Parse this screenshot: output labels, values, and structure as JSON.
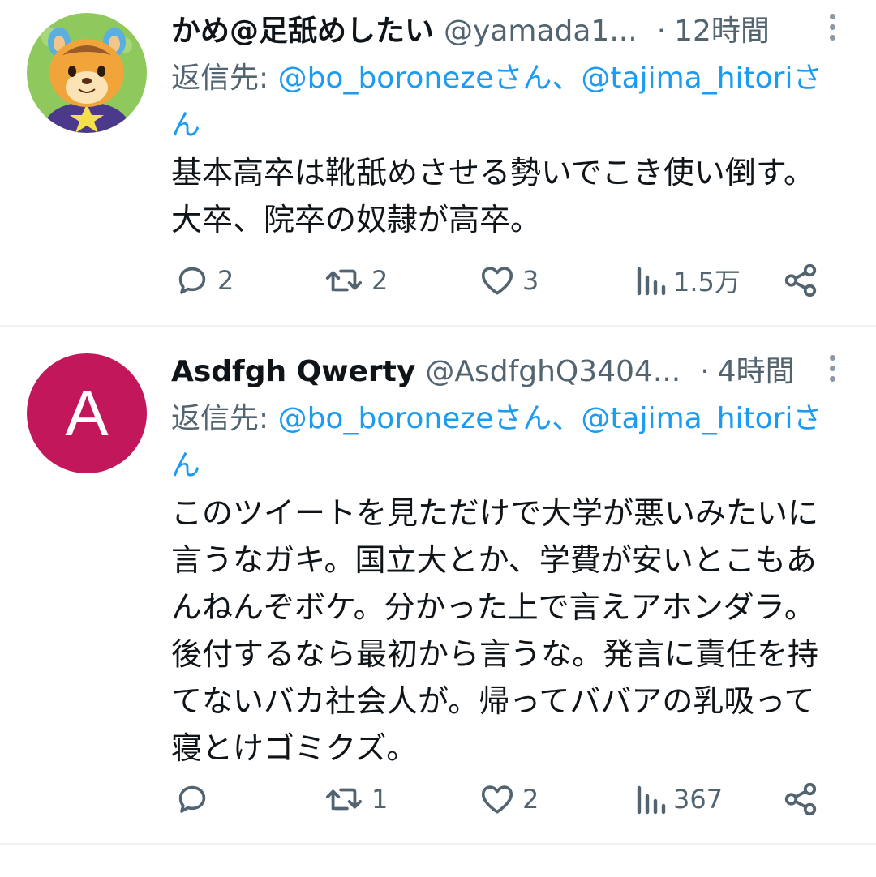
{
  "tweets": [
    {
      "display_name": "かめ@足舐めしたい",
      "handle": "@yamada1...",
      "separator": "·",
      "time": "12時間",
      "reply_prefix": "返信先: ",
      "mention_1": "@bo_boronezeさん",
      "mention_joiner": "、",
      "mention_2": "@tajima_hitoriさん",
      "body": "基本高卒は靴舐めさせる勢いでこき使い倒す。大卒、院卒の奴隷が高卒。",
      "replies": "2",
      "retweets": "2",
      "likes": "3",
      "views": "1.5万"
    },
    {
      "display_name": "Asdfgh Qwerty",
      "avatar_letter": "A",
      "handle": "@AsdfghQ3404...",
      "separator": "·",
      "time": "4時間",
      "reply_prefix": "返信先: ",
      "mention_1": "@bo_boronezeさん",
      "mention_joiner": "、",
      "mention_2": "@tajima_hitoriさん",
      "body": "このツイートを見ただけで大学が悪いみたいに言うなガキ。国立大とか、学費が安いとこもあんねんぞボケ。分かった上で言えアホンダラ。後付するなら最初から言うな。発言に責任を持てないバカ社会人が。帰ってババアの乳吸って寝とけゴミクズ。",
      "replies": "",
      "retweets": "1",
      "likes": "2",
      "views": "367"
    }
  ],
  "icons": {
    "more": "more-vertical-icon",
    "reply": "reply-icon",
    "retweet": "retweet-icon",
    "like": "heart-icon",
    "views": "views-chart-icon",
    "share": "share-icon"
  },
  "colors": {
    "text": "#0f1419",
    "secondary": "#536471",
    "link": "#1d9bf0",
    "avatar_bg": "#c2185b",
    "divider": "#eff3f4"
  }
}
